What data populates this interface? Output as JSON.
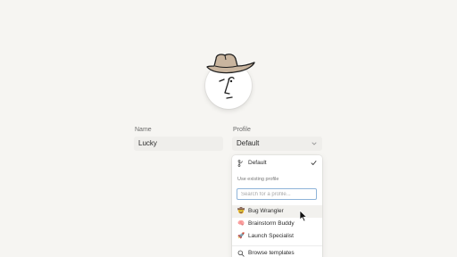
{
  "form": {
    "name_label": "Name",
    "name_value": "Lucky",
    "profile_label": "Profile",
    "profile_value": "Default"
  },
  "dropdown": {
    "default_item": "Default",
    "section_label": "Use existing profile",
    "search_placeholder": "Search for a profile...",
    "profiles": [
      {
        "label": "Bug Wrangler",
        "icon": "smiley-cowboy-icon"
      },
      {
        "label": "Brainstorm Buddy",
        "icon": "brain-icon"
      },
      {
        "label": "Launch Specialist",
        "icon": "rocket-icon"
      }
    ],
    "browse_label": "Browse templates"
  },
  "colors": {
    "background": "#f6f5f2",
    "input_bg": "#efeeeb",
    "hat": "#c9b59f",
    "focus_border": "#8fb4d9"
  }
}
